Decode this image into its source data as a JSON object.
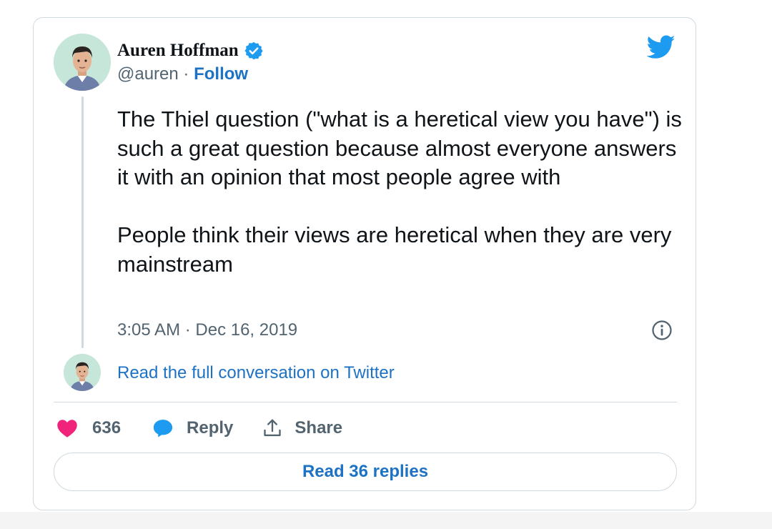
{
  "tweet": {
    "author": {
      "name": "Auren Hoffman",
      "handle": "@auren",
      "separator": "·",
      "follow_label": "Follow",
      "verified_icon": "verified-badge-icon",
      "avatar_icon": "avatar-illustration"
    },
    "brand_icon": "twitter-bird-icon",
    "text": {
      "paragraph_1": "The Thiel question (\"what is a heretical view you have\") is such a great question because almost everyone answers it with an opinion that most people agree with",
      "paragraph_2": "People think their views are heretical when they are very mainstream"
    },
    "timestamp": "3:05 AM · Dec 16, 2019",
    "info_icon": "info-icon",
    "conversation_link": "Read the full conversation on Twitter",
    "actions": {
      "like_count": "636",
      "reply_label": "Reply",
      "share_label": "Share"
    },
    "read_replies_label": "Read 36 replies"
  },
  "colors": {
    "link": "#1d72c4",
    "twitter_blue": "#1d9bf0",
    "like": "#f0247b",
    "secondary_text": "#536471",
    "border": "#cfd9de"
  }
}
